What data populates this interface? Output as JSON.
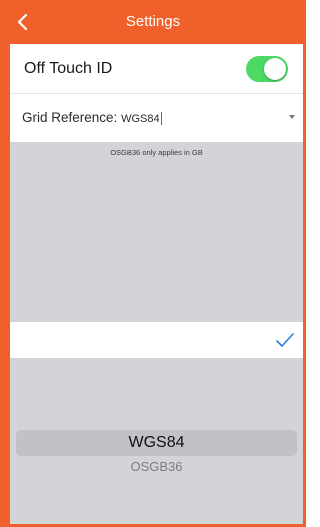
{
  "header": {
    "title": "Settings",
    "back_icon": "chevron-left-icon"
  },
  "touch_id": {
    "label": "Off Touch ID",
    "enabled": true
  },
  "grid_reference": {
    "label": "Grid Reference:",
    "value": "WGS84"
  },
  "note": "OSGB36 only applies in GB",
  "picker": {
    "done_icon": "checkmark-icon",
    "selected": "WGS84",
    "options": [
      "WGS84",
      "OSGB36"
    ]
  },
  "colors": {
    "accent": "#f0602a",
    "toggle_on": "#4cd964",
    "check": "#2f7fe0"
  }
}
